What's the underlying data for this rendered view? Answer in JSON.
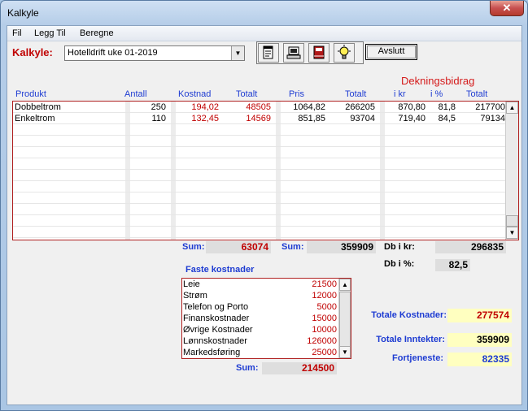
{
  "window": {
    "title": "Kalkyle",
    "close": "✕"
  },
  "menu": [
    "Fil",
    "Legg Til",
    "Beregne"
  ],
  "kalkyle": {
    "label": "Kalkyle:",
    "selected": "Hotelldrift uke 01-2019"
  },
  "toolbar": {
    "icons": [
      "notepad-icon",
      "computer-icon",
      "book-icon",
      "lightbulb-icon"
    ],
    "avslutt": "Avslutt"
  },
  "headers": {
    "dekningsbidrag": "Dekningsbidrag",
    "produkt": "Produkt",
    "antall": "Antall",
    "kostnad": "Kostnad",
    "totalt1": "Totalt",
    "pris": "Pris",
    "totalt2": "Totalt",
    "ikr": "i kr",
    "iprosent": "i %",
    "totalt3": "Totalt"
  },
  "rows": [
    {
      "produkt": "Dobbeltrom",
      "antall": "250",
      "kostnad": "194,02",
      "totalt": "48505",
      "pris": "1064,82",
      "totalt2": "266205",
      "ikr": "870,80",
      "iprosent": "81,8",
      "totalt3": "217700"
    },
    {
      "produkt": "Enkeltrom",
      "antall": "110",
      "kostnad": "132,45",
      "totalt": "14569",
      "pris": "851,85",
      "totalt2": "93704",
      "ikr": "719,40",
      "iprosent": "84,5",
      "totalt3": "79134"
    }
  ],
  "sums": {
    "sum_label": "Sum:",
    "sum_kostnad": "63074",
    "sum2_label": "Sum:",
    "sum_inntekt": "359909",
    "db_kr_label": "Db i kr:",
    "db_kr": "296835",
    "db_pct_label": "Db i %:",
    "db_pct": "82,5"
  },
  "faste": {
    "title": "Faste kostnader",
    "items": [
      {
        "name": "Leie",
        "value": "21500"
      },
      {
        "name": "Strøm",
        "value": "12000"
      },
      {
        "name": "Telefon  og  Porto",
        "value": "5000"
      },
      {
        "name": "Finanskostnader",
        "value": "15000"
      },
      {
        "name": "Øvrige Kostnader",
        "value": "10000"
      },
      {
        "name": "Lønnskostnader",
        "value": "126000"
      },
      {
        "name": "Markedsføring",
        "value": "25000"
      }
    ],
    "sum_label": "Sum:",
    "sum": "214500"
  },
  "totals": {
    "kost_label": "Totale Kostnader:",
    "kost": "277574",
    "innt_label": "Totale Inntekter:",
    "innt": "359909",
    "fort_label": "Fortjeneste:",
    "fort": "82335"
  }
}
